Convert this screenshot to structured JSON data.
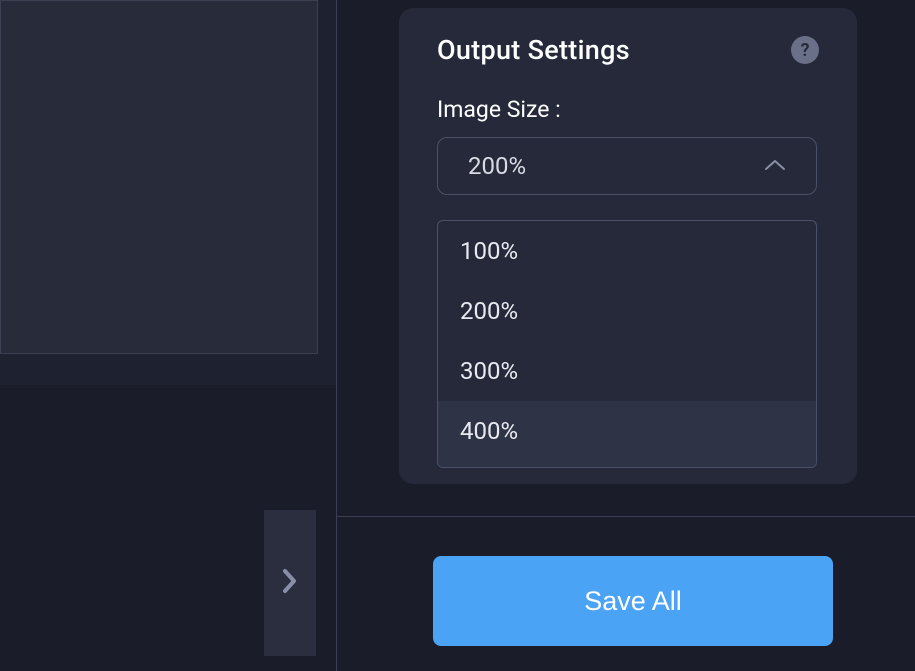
{
  "settings": {
    "title": "Output Settings",
    "image_size_label": "Image Size :",
    "selected_value": "200%",
    "options": [
      "100%",
      "200%",
      "300%",
      "400%"
    ],
    "hovered_index": 3
  },
  "actions": {
    "save_all_label": "Save All"
  },
  "icons": {
    "help": "?",
    "chevron_up": "chevron-up",
    "chevron_right": "chevron-right"
  },
  "colors": {
    "accent": "#4aa3f5",
    "background": "#1a1d29",
    "card": "#252939",
    "border": "#4a5068"
  }
}
